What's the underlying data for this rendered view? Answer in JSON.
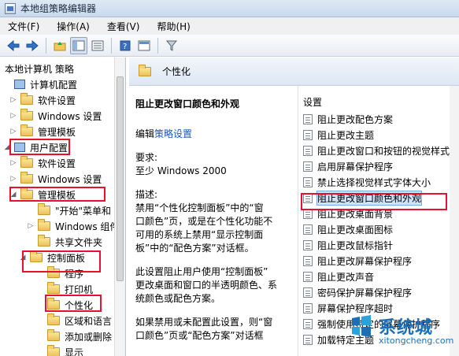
{
  "window": {
    "title": "本地组策略编辑器"
  },
  "menu": [
    "文件(F)",
    "操作(A)",
    "查看(V)",
    "帮助(H)"
  ],
  "toolbar": [
    "back-icon",
    "forward-icon",
    "up-folder-icon",
    "show-hide-tree-icon",
    "list-icon",
    "help-icon",
    "properties-icon",
    "filter-icon"
  ],
  "tree": {
    "root": "本地计算机 策略",
    "items": [
      {
        "label": "计算机配置",
        "icon": "computer-icon",
        "expander": ""
      },
      {
        "label": "软件设置",
        "icon": "folder-icon",
        "expander": "▷"
      },
      {
        "label": "Windows 设置",
        "icon": "folder-icon",
        "expander": "▷"
      },
      {
        "label": "管理模板",
        "icon": "folder-icon",
        "expander": "▷"
      },
      {
        "label": "用户配置",
        "icon": "computer-icon",
        "expander": "◢"
      },
      {
        "label": "软件设置",
        "icon": "folder-icon",
        "expander": "▷"
      },
      {
        "label": "Windows 设置",
        "icon": "folder-icon",
        "expander": "▷"
      },
      {
        "label": "管理模板",
        "icon": "folder-icon",
        "expander": "◢"
      },
      {
        "label": "\"开始\"菜单和",
        "icon": "folder-icon",
        "expander": ""
      },
      {
        "label": "Windows 组件",
        "icon": "folder-icon",
        "expander": "▷"
      },
      {
        "label": "共享文件夹",
        "icon": "folder-icon",
        "expander": ""
      },
      {
        "label": "控制面板",
        "icon": "folder-icon",
        "expander": "◢"
      },
      {
        "label": "程序",
        "icon": "folder-icon",
        "expander": ""
      },
      {
        "label": "打印机",
        "icon": "folder-icon",
        "expander": ""
      },
      {
        "label": "个性化",
        "icon": "folder-icon",
        "expander": ""
      },
      {
        "label": "区域和语言",
        "icon": "folder-icon",
        "expander": ""
      },
      {
        "label": "添加或删除",
        "icon": "folder-icon",
        "expander": ""
      },
      {
        "label": "显示",
        "icon": "folder-icon",
        "expander": ""
      }
    ]
  },
  "detail": {
    "header": "个性化",
    "setting_title": "阻止更改窗口颜色和外观",
    "edit_prefix": "编辑",
    "edit_link": "策略设置",
    "requirements_label": "要求:",
    "requirements_value": "至少 Windows 2000",
    "description_label": "描述:",
    "description_lines": [
      "禁用“个性化控制面板”中的“窗",
      "口颜色”页，或是在个性化功能不",
      "可用的系统上禁用“显示控制面",
      "板”中的“配色方案”对话框。"
    ],
    "description2_lines": [
      "此设置阻止用户使用“控制面板”",
      "更改桌面和窗口的半透明颜色、系",
      "统颜色或配色方案。"
    ],
    "description3_lines": [
      "如果禁用或未配置此设置，则“窗",
      "口颜色”页或“配色方案”对话框"
    ]
  },
  "settings": {
    "header": "设置",
    "items": [
      "阻止更改配色方案",
      "阻止更改主题",
      "阻止更改窗口和按钮的视觉样式",
      "启用屏幕保护程序",
      "禁止选择视觉样式字体大小",
      "阻止更改窗口颜色和外观",
      "阻止更改桌面背景",
      "阻止更改桌面图标",
      "阻止更改鼠标指针",
      "阻止更改屏幕保护程序",
      "阻止更改声音",
      "密码保护屏幕保护程序",
      "屏幕保护程序超时",
      "强制使用特定的屏幕保护程序",
      "加载特定主题"
    ],
    "selected_index": 5
  },
  "watermark": {
    "text": "系统城",
    "url": "xitongcheng.com"
  },
  "colors": {
    "highlight_box": "#e8112d",
    "selection": "#cfe3fb",
    "link": "#1a56c4"
  }
}
